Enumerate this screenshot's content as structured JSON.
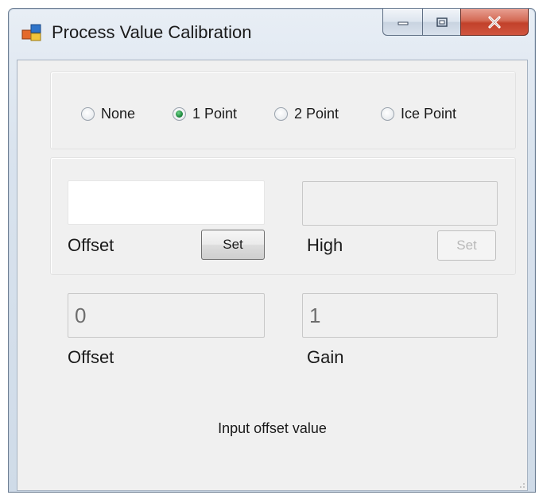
{
  "window": {
    "title": "Process Value Calibration",
    "icon": "app-window-icon",
    "caption_buttons": [
      "minimize-icon",
      "maximize-icon",
      "close-icon"
    ]
  },
  "calibration_mode": {
    "options": [
      "None",
      "1 Point",
      "2 Point",
      "Ice Point"
    ],
    "selected": "1 Point"
  },
  "entry": {
    "offset_value": "",
    "offset_label": "Offset",
    "offset_set_label": "Set",
    "high_value": "",
    "high_label": "High",
    "high_set_label": "Set"
  },
  "result": {
    "offset_value": "0",
    "offset_label": "Offset",
    "gain_value": "1",
    "gain_label": "Gain"
  },
  "status_text": "Input offset value",
  "colors": {
    "selected_radio": "#1f8a3f",
    "close_button": "#c2412a"
  }
}
